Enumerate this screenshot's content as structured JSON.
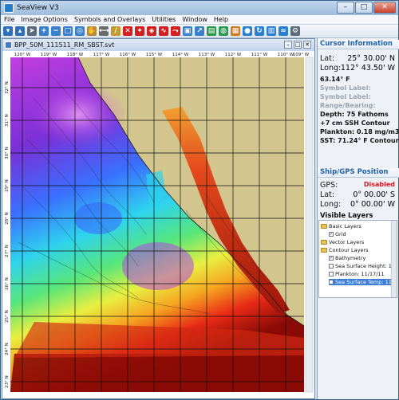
{
  "window": {
    "title": "SeaView V3",
    "min": "–",
    "max": "□",
    "close": "✕"
  },
  "menu": [
    "File",
    "Image Options",
    "Symbols and Overlays",
    "Utilities",
    "Window",
    "Help"
  ],
  "toolbar_icons": [
    "save-icon",
    "export-icon",
    "pointer-icon",
    "zoom-in-icon",
    "zoom-out-icon",
    "zoom-window-icon",
    "zoom-extent-icon",
    "pan-hand-icon",
    "measure-icon",
    "ruler-icon",
    "delete-icon",
    "symbol-icon",
    "target-icon",
    "line-tool-icon",
    "route-icon",
    "image-icon",
    "arrow-icon",
    "data-icon",
    "contour-icon",
    "layers-icon",
    "globe-icon",
    "refresh-icon",
    "chart-icon",
    "tide-icon",
    "settings-icon"
  ],
  "map": {
    "title": "BPP_50M_111511_RM_SBST.svt",
    "lon_labels": [
      "120° W",
      "119° W",
      "118° W",
      "117° W",
      "116° W",
      "115° W",
      "114° W",
      "113° W",
      "112° W",
      "111° W",
      "110° W",
      "109° W"
    ],
    "lat_labels": [
      "32° N",
      "31° N",
      "30° N",
      "29° N",
      "28° N",
      "27° N",
      "26° N",
      "25° N",
      "24° N",
      "23° N"
    ]
  },
  "cursor": {
    "header": "Cursor Information",
    "lat_label": "Lat:",
    "lat": "25° 30.00' N",
    "long_label": "Long:",
    "long": "112° 43.50' W",
    "temp": "63.14° F",
    "symbol_label1": "Symbol Label:",
    "symbol_label2": "Symbol Label:",
    "range_bearing": "Range/Bearing:",
    "depth": "Depth: 75 Fathoms",
    "ssh": "+7 cm SSH Contour",
    "plankton": "Plankton: 0.18 mg/m3",
    "sst": "SST: 71.24° F Contour"
  },
  "ship": {
    "header": "Ship/GPS Position",
    "gps_label": "GPS:",
    "gps_status": "Disabled",
    "lat_label": "Lat:",
    "lat": "0° 00.00' S",
    "long_label": "Long:",
    "long": "0° 00.00' W"
  },
  "layers": {
    "header": "Visible Layers",
    "basic": "Basic Layers",
    "grid": "Grid",
    "vector": "Vector Layers",
    "contour": "Contour Layers",
    "bathymetry": "Bathymetry",
    "ssh": "Sea Surface Height: 11/1",
    "plankton": "Plankton: 11/17/11",
    "sst": "Sea Surface Temp: 11/15"
  }
}
